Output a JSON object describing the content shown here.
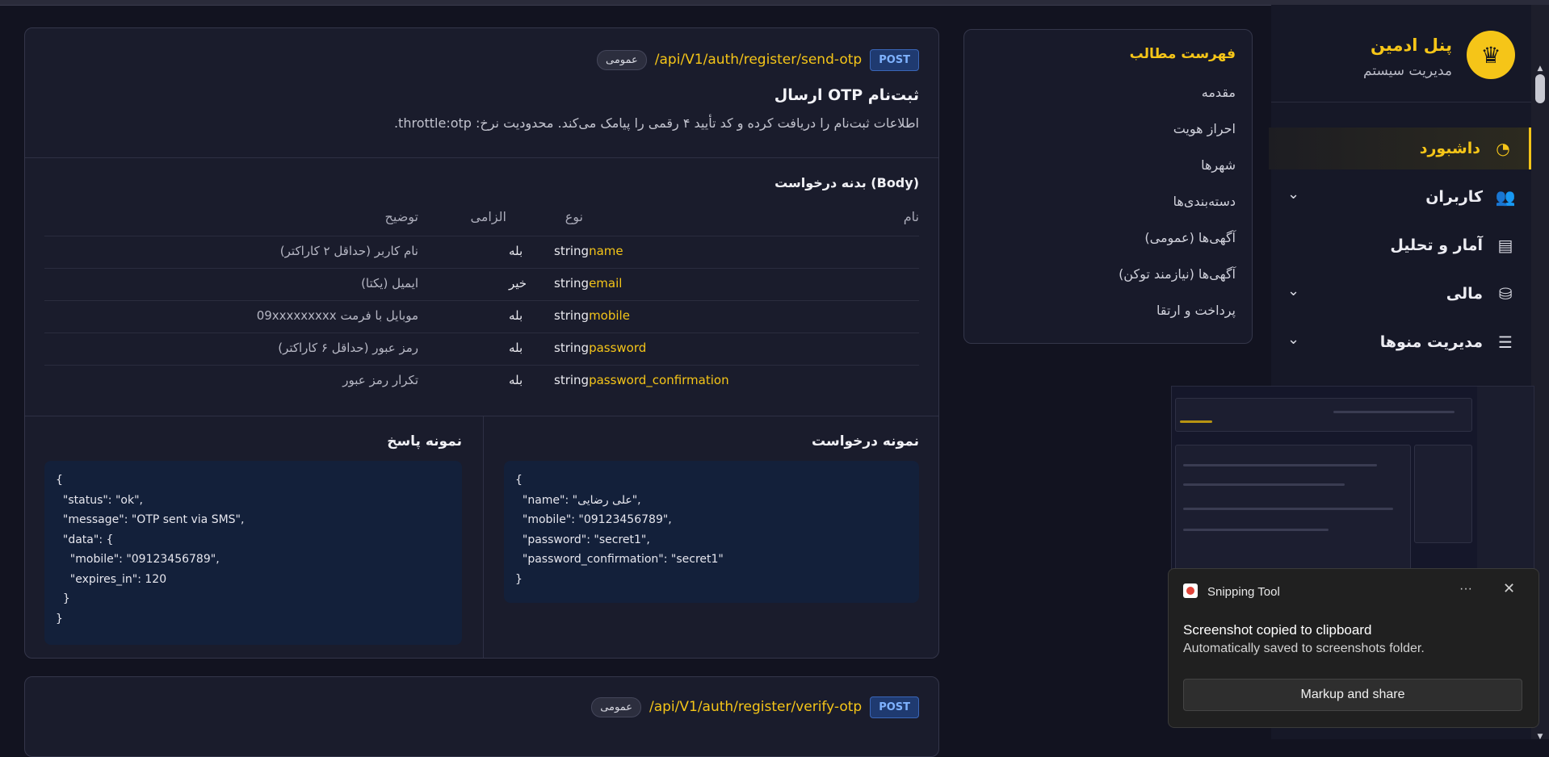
{
  "sidebar": {
    "brand_title": "پنل ادمین",
    "brand_subtitle": "مدیریت سیستم",
    "items": [
      {
        "label": "داشبورد",
        "icon": "gauge-icon",
        "active": true
      },
      {
        "label": "کاربران",
        "icon": "users-icon",
        "expandable": true
      },
      {
        "label": "آمار و تحلیل",
        "icon": "chart-icon"
      },
      {
        "label": "مالی",
        "icon": "coins-icon",
        "expandable": true
      },
      {
        "label": "مدیریت منوها",
        "icon": "menu-icon",
        "expandable": true
      }
    ]
  },
  "toc": {
    "title": "فهرست مطالب",
    "items": [
      "مقدمه",
      "احراز هویت",
      "شهرها",
      "دسته‌بندی‌ها",
      "آگهی‌ها (عمومی)",
      "آگهی‌ها (نیازمند توکن)",
      "پرداخت و ارتقا"
    ]
  },
  "endpoint": {
    "method": "POST",
    "path": "/api/V1/auth/register/send-otp",
    "visibility": "عمومی",
    "title": "ارسال OTP ثبت‌نام",
    "description": "اطلاعات ثبت‌نام را دریافت کرده و کد تأیید ۴ رقمی را پیامک می‌کند. محدودیت نرخ: throttle:otp.",
    "body_title": "بدنه درخواست (Body)",
    "columns": {
      "name": "نام",
      "type": "نوع",
      "required": "الزامی",
      "description": "توضیح"
    },
    "params": [
      {
        "name": "name",
        "type": "string",
        "required": "بله",
        "description": "نام کاربر (حداقل ۲ کاراکتر)"
      },
      {
        "name": "email",
        "type": "string",
        "required": "خیر",
        "description": "ایمیل (یکتا)"
      },
      {
        "name": "mobile",
        "type": "string",
        "required": "بله",
        "description": "موبایل با فرمت 09xxxxxxxxx"
      },
      {
        "name": "password",
        "type": "string",
        "required": "بله",
        "description": "رمز عبور (حداقل ۶ کاراکتر)"
      },
      {
        "name": "password_confirmation",
        "type": "string",
        "required": "بله",
        "description": "تکرار رمز عبور"
      }
    ],
    "request_example_title": "نمونه درخواست",
    "request_example": "{\n  \"name\": \"علی رضایی\",\n  \"mobile\": \"09123456789\",\n  \"password\": \"secret1\",\n  \"password_confirmation\": \"secret1\"\n}",
    "response_example_title": "نمونه پاسخ",
    "response_example": "{\n  \"status\": \"ok\",\n  \"message\": \"OTP sent via SMS\",\n  \"data\": {\n    \"mobile\": \"09123456789\",\n    \"expires_in\": 120\n  }\n}"
  },
  "endpoint2": {
    "method": "POST",
    "path": "/api/V1/auth/register/verify-otp",
    "visibility": "عمومی"
  },
  "toast": {
    "app_name": "Snipping Tool",
    "more": "···",
    "close": "✕",
    "heading": "Screenshot copied to clipboard",
    "message": "Automatically saved to screenshots folder.",
    "button": "Markup and share"
  },
  "colors": {
    "accent": "#f5c518",
    "background": "#121320",
    "card": "#1a1c2c",
    "method_badge": "#1f3a70"
  }
}
